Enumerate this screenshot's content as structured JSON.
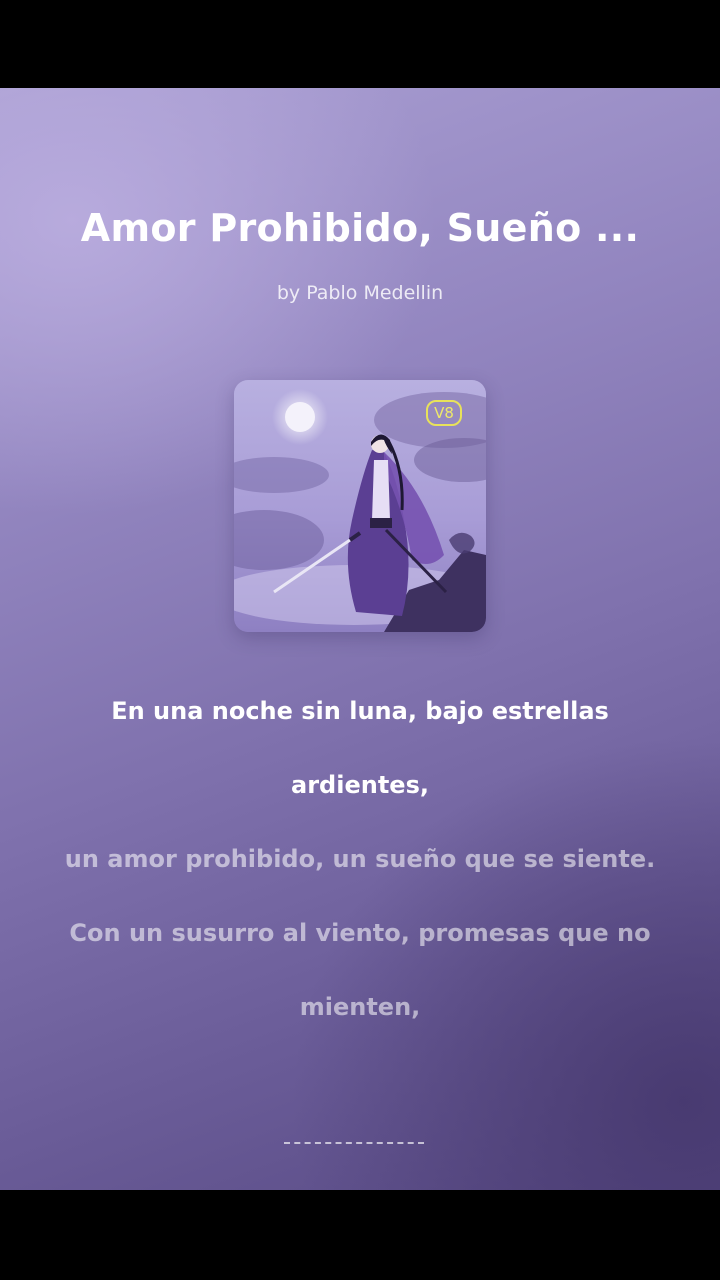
{
  "song": {
    "title": "Amor Prohibido, Sueño ...",
    "artist": "by Pablo Medellin",
    "version_badge": "V8",
    "cover_icon": "cover-art-swordsman-moon"
  },
  "lyrics": [
    {
      "text": "En una noche sin luna, bajo estrellas ardientes,",
      "state": "active"
    },
    {
      "text": "un amor prohibido, un sueño que se siente.",
      "state": "upcoming"
    },
    {
      "text": "Con un susurro al viento, promesas que no mienten,",
      "state": "upcoming"
    }
  ],
  "colors": {
    "accent_badge": "#e8e25a",
    "background_top": "#aa9fd3",
    "background_bottom": "#584a84"
  }
}
